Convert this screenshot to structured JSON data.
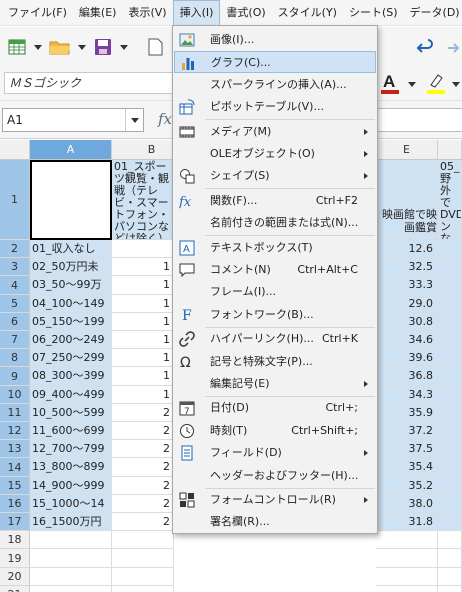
{
  "menubar": [
    "ファイル(F)",
    "編集(E)",
    "表示(V)",
    "挿入(I)",
    "書式(O)",
    "スタイル(Y)",
    "シート(S)",
    "データ(D)"
  ],
  "font_name": "ＭＳゴシック",
  "name_box": "A1",
  "columns": [
    "A",
    "B",
    "E"
  ],
  "header_row": {
    "num": "1",
    "b_text": "01_スポーツ観覧・観戦（テレビ・スマートフォン・パソコンなどは除く）",
    "e_text": "映画館で映画鑑賞",
    "f_text": "05_野外で DVD ンな"
  },
  "rows": [
    {
      "num": "2",
      "a": "01_収入なし",
      "b": "",
      "e": "12.6"
    },
    {
      "num": "3",
      "a": "02_50万円未",
      "b": "1",
      "e": "32.5"
    },
    {
      "num": "4",
      "a": "03_50～99万",
      "b": "1",
      "e": "33.3"
    },
    {
      "num": "5",
      "a": "04_100～149",
      "b": "1",
      "e": "29.0"
    },
    {
      "num": "6",
      "a": "05_150～199",
      "b": "1",
      "e": "30.8"
    },
    {
      "num": "7",
      "a": "06_200～249",
      "b": "1",
      "e": "34.6"
    },
    {
      "num": "8",
      "a": "07_250～299",
      "b": "1",
      "e": "39.6"
    },
    {
      "num": "9",
      "a": "08_300～399",
      "b": "1",
      "e": "36.8"
    },
    {
      "num": "10",
      "a": "09_400～499",
      "b": "1",
      "e": "34.3"
    },
    {
      "num": "11",
      "a": "10_500～599",
      "b": "2",
      "e": "35.9"
    },
    {
      "num": "12",
      "a": "11_600～699",
      "b": "2",
      "e": "37.2"
    },
    {
      "num": "13",
      "a": "12_700～799",
      "b": "2",
      "e": "37.5"
    },
    {
      "num": "14",
      "a": "13_800～899",
      "b": "2",
      "e": "35.4"
    },
    {
      "num": "15",
      "a": "14_900～999",
      "b": "2",
      "e": "35.2"
    },
    {
      "num": "16",
      "a": "15_1000～14",
      "b": "2",
      "e": "38.0"
    },
    {
      "num": "17",
      "a": "16_1500万円",
      "b": "2",
      "e": "31.8"
    },
    {
      "num": "18",
      "a": "",
      "b": "",
      "e": ""
    },
    {
      "num": "19",
      "a": "",
      "b": "",
      "e": ""
    },
    {
      "num": "20",
      "a": "",
      "b": "",
      "e": ""
    },
    {
      "num": "21",
      "a": "",
      "b": "",
      "e": ""
    }
  ],
  "insert_menu": {
    "items": [
      {
        "label": "画像(I)...",
        "icon": "image-icon",
        "shortcut": ""
      },
      {
        "label": "グラフ(C)...",
        "icon": "chart-icon",
        "shortcut": ""
      },
      {
        "label": "スパークラインの挿入(A)...",
        "icon": "",
        "shortcut": ""
      },
      {
        "label": "ピボットテーブル(V)...",
        "icon": "pivot-table-icon",
        "shortcut": ""
      },
      {
        "label": "メディア(M)",
        "icon": "media-icon",
        "shortcut": ""
      },
      {
        "label": "OLEオブジェクト(O)",
        "icon": "",
        "shortcut": ""
      },
      {
        "label": "シェイプ(S)",
        "icon": "shape-icon",
        "shortcut": ""
      },
      {
        "label": "関数(F)...",
        "icon": "function-icon",
        "shortcut": "Ctrl+F2"
      },
      {
        "label": "名前付きの範囲または式(N)...",
        "icon": "",
        "shortcut": ""
      },
      {
        "label": "テキストボックス(T)",
        "icon": "textbox-icon",
        "shortcut": ""
      },
      {
        "label": "コメント(N)",
        "icon": "comment-icon",
        "shortcut": "Ctrl+Alt+C"
      },
      {
        "label": "フレーム(I)...",
        "icon": "",
        "shortcut": ""
      },
      {
        "label": "フォントワーク(B)...",
        "icon": "fontwork-icon",
        "shortcut": ""
      },
      {
        "label": "ハイパーリンク(H)...",
        "icon": "hyperlink-icon",
        "shortcut": "Ctrl+K"
      },
      {
        "label": "記号と特殊文字(P)...",
        "icon": "omega-icon",
        "shortcut": ""
      },
      {
        "label": "編集記号(E)",
        "icon": "",
        "shortcut": ""
      },
      {
        "label": "日付(D)",
        "icon": "calendar-icon",
        "shortcut": "Ctrl+;"
      },
      {
        "label": "時刻(T)",
        "icon": "clock-icon",
        "shortcut": "Ctrl+Shift+;"
      },
      {
        "label": "フィールド(D)",
        "icon": "field-icon",
        "shortcut": ""
      },
      {
        "label": "ヘッダーおよびフッター(H)...",
        "icon": "",
        "shortcut": ""
      },
      {
        "label": "フォームコントロール(R)",
        "icon": "form-control-icon",
        "shortcut": ""
      },
      {
        "label": "署名欄(R)...",
        "icon": "",
        "shortcut": ""
      }
    ]
  },
  "colors": {
    "selection": "#cfe2f3",
    "menu_highlight": "#cfe2f6",
    "header_selected": "#6fa8dc"
  }
}
